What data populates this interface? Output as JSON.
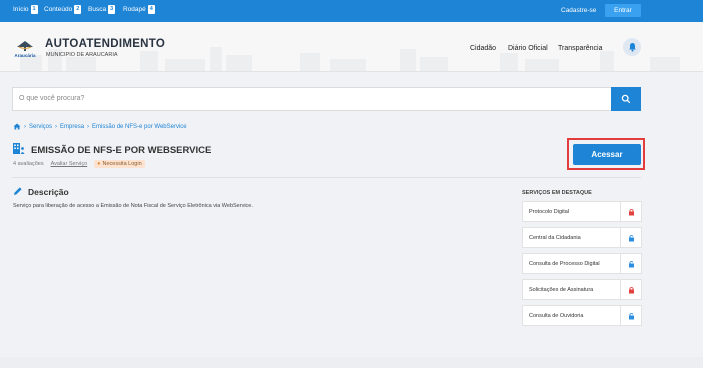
{
  "accessibility_bar": {
    "items": [
      {
        "label": "Início",
        "key": "1"
      },
      {
        "label": "Conteúdo",
        "key": "2"
      },
      {
        "label": "Busca",
        "key": "3"
      },
      {
        "label": "Rodapé",
        "key": "4"
      }
    ],
    "signup_label": "Cadastre-se",
    "login_label": "Entrar"
  },
  "header": {
    "logo_text": "Araucária",
    "title": "AUTOATENDIMENTO",
    "subtitle": "MUNICIPIO DE ARAUCARIA",
    "nav": [
      "Cidadão",
      "Diário Oficial",
      "Transparência"
    ],
    "bell_icon": "bell-icon"
  },
  "search": {
    "placeholder": "O que você procura?",
    "icon": "search-icon"
  },
  "breadcrumb": {
    "home_icon": "home-icon",
    "items": [
      "Serviços",
      "Empresa",
      "Emissão de NFS-e por WebService"
    ]
  },
  "service": {
    "icon": "building-people-icon",
    "title": "EMISSÃO DE NFS-E POR WEBSERVICE",
    "ratings": "4 avaliações",
    "rate_link": "Avaliar Serviço",
    "badge": "Necessita Login",
    "access_button": "Acessar"
  },
  "description": {
    "title": "Descrição",
    "text": "Serviço para liberação de acesso a Emissão de Nota Fiscal de Serviço Eletrônica via WebService."
  },
  "featured": {
    "title": "SERVIÇOS EM DESTAQUE",
    "items": [
      {
        "label": "Protocolo Digital",
        "lock": "locked",
        "lock_color": "#e2403f"
      },
      {
        "label": "Central da Cidadania",
        "lock": "unlocked",
        "lock_color": "#2b8ee0"
      },
      {
        "label": "Consulta de Processo Digital",
        "lock": "unlocked",
        "lock_color": "#2b8ee0"
      },
      {
        "label": "Solicitações de Assinatura",
        "lock": "locked",
        "lock_color": "#e2403f"
      },
      {
        "label": "Consulta de Ouvidoria",
        "lock": "unlocked",
        "lock_color": "#2b8ee0"
      }
    ]
  },
  "colors": {
    "primary": "#1d84d6",
    "highlight_border": "#e23c3c"
  }
}
